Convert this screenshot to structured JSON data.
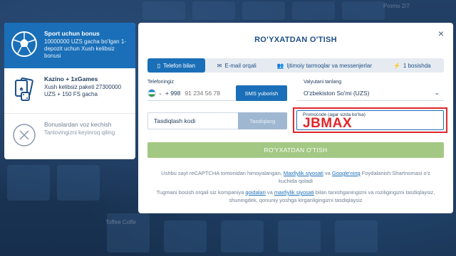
{
  "background": {
    "labels": [
      "Promo 2/7",
      "Toffee Coffe"
    ]
  },
  "bonus": {
    "items": [
      {
        "title": "Sport uchun bonus",
        "desc": "10000000 UZS gacha bo'lgan 1-depozit uchun Xush kelibsiz bonusi"
      },
      {
        "title": "Kazino + 1xGames",
        "desc": "Xush kelibsiz paketi 27300000 UZS + 150 FS gacha"
      },
      {
        "title": "Bonuslardan voz kechish",
        "desc": "Tanlovingizni keyinroq qiling"
      }
    ]
  },
  "modal": {
    "title": "RO'YXATDAN O'TISH",
    "close": "×",
    "tabs": [
      {
        "label": "Telefon bilan",
        "icon": "phone-icon",
        "glyph": "▯"
      },
      {
        "label": "E-mail orqali",
        "icon": "mail-icon",
        "glyph": "✉"
      },
      {
        "label": "Ijtimoiy tarmoqlar va messenjerlar",
        "icon": "users-icon",
        "glyph": "👥"
      },
      {
        "label": "1 bosishda",
        "icon": "lightning-icon",
        "glyph": "⚡"
      }
    ],
    "phone": {
      "label": "Telefoningiz",
      "prefix": "+ 998",
      "placeholder": "91 234 56 78",
      "sms_button": "SMS yuborish"
    },
    "currency": {
      "label": "Valyutani tanlang",
      "value": "O'zbekiston So'mi (UZS)"
    },
    "confirm": {
      "placeholder": "Tasdiqlash kodi",
      "button": "Tasdiqlang"
    },
    "promo": {
      "label": "Promocode (agar sizda bo'lsa)",
      "value": "JBMAX"
    },
    "register_button": "RO'YXATDAN O'TISH",
    "note1_pre": "Ushbu sayt reCAPTCHA tomonidan himoyalangan,",
    "note1_link1": "Maxfiylik siyosati",
    "note1_mid": "va",
    "note1_link2": "Google'ning",
    "note1_post": "Foydalanish Shartnomasi o'z kuchida qoladi",
    "note2_pre": "Tugmani bosish orqali siz kompaniya",
    "note2_link1": "qoidalari",
    "note2_mid": "va",
    "note2_link2": "maxfiylik siyosati",
    "note2_post": "bilan tanishganingizni va roziligingizni tasdiqlaysiz, shuningdek, qonuniy yoshga kirganligingizni tasdiqlaysiz"
  },
  "colors": {
    "primary": "#1a6fb8",
    "register": "#a3c883",
    "promo_highlight": "#e0262a"
  }
}
